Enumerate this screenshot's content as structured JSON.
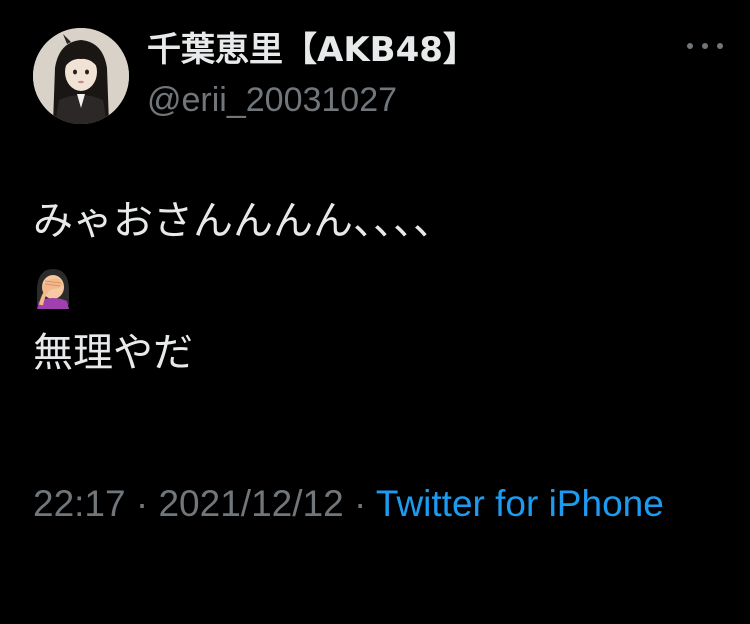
{
  "user": {
    "display_name": "千葉恵里【AKB48】",
    "handle": "@erii_20031027"
  },
  "tweet": {
    "line1": "みゃおさんんんん、、、、",
    "emoji": "face-palm-emoji",
    "line3": "無理やだ"
  },
  "meta": {
    "time": "22:17",
    "separator": " · ",
    "date": "2021/12/12",
    "source": "Twitter for iPhone"
  },
  "colors": {
    "background": "#000000",
    "primary_text": "#e7e9ea",
    "secondary_text": "#71767b",
    "link": "#1d9bf0"
  }
}
